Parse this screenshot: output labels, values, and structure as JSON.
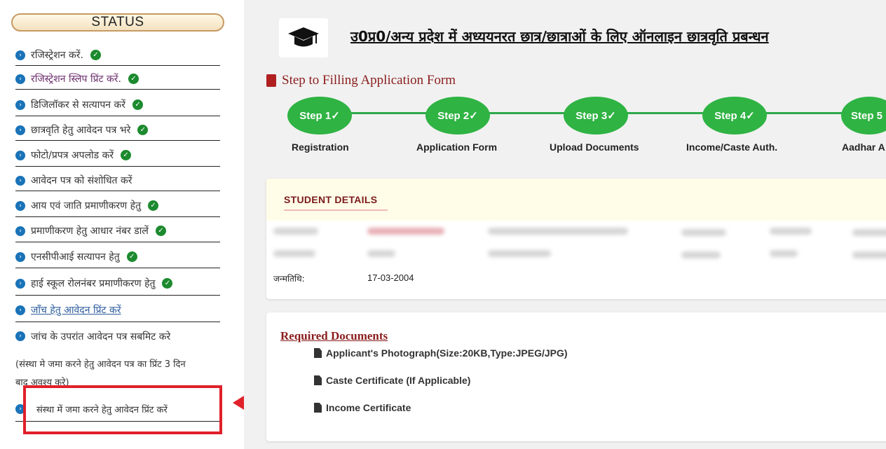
{
  "sidebar": {
    "status_title": "STATUS",
    "items": [
      {
        "label": "रजिस्ट्रेशन करें.",
        "done": true
      },
      {
        "label": "रजिस्ट्रेशन स्लिप प्रिंट करें.",
        "done": true
      },
      {
        "label": "डिजिलॉकर से सत्यापन करें",
        "done": true
      },
      {
        "label": "छात्रवृति हेतु आवेदन पत्र भरे",
        "done": true
      },
      {
        "label": "फोटो/प्रपत्र अपलोड करें",
        "done": true
      },
      {
        "label": "आवेदन पत्र को संशोधित करें",
        "done": false
      },
      {
        "label": "आय एवं जाति प्रमाणीकरण हेतु",
        "done": true
      },
      {
        "label": "प्रमाणीकरण हेतु आधार नंबर डालें",
        "done": true
      },
      {
        "label": "एनसीपीआई सत्यापन हेतु",
        "done": true
      },
      {
        "label": "हाई स्कूल रोलनंबर प्रमाणीकरण हेतु",
        "done": true
      },
      {
        "label": "जाँच हेतु आवेदन प्रिंट करें",
        "done": false
      },
      {
        "label": "जांच के उपरांत आवेदन पत्र सबमिट करे",
        "done": false
      }
    ],
    "note_line1": "(संस्था मे जमा करने हेतु आवेदन पत्र का प्रिंट 3 दिन",
    "note_line2": "बाद अवश्य करे)",
    "last_item": "संस्था में जमा करने हेतु आवेदन प्रिंट करें"
  },
  "header": {
    "title": "उ0प्र0/अन्य प्रदेश में अध्ययनरत छात्र/छात्राओं के लिए ऑनलाइन छात्रवृति प्रबन्धन"
  },
  "steps_label": "Step to Filling Application Form",
  "steps": [
    {
      "badge": "Step 1",
      "label": "Registration"
    },
    {
      "badge": "Step 2",
      "label": "Application Form"
    },
    {
      "badge": "Step 3",
      "label": "Upload Documents"
    },
    {
      "badge": "Step 4",
      "label": "Income/Caste Auth."
    },
    {
      "badge": "Step 5",
      "label": "Aadhar A"
    }
  ],
  "student_details": {
    "title": "STUDENT DETAILS",
    "dob_label": "जन्मतिथि:",
    "dob_value": "17-03-2004"
  },
  "required_documents": {
    "title": "Required Documents",
    "items": [
      "Applicant's Photograph(Size:20KB,Type:JPEG/JPG)",
      "Caste Certificate (If Applicable)",
      "Income Certificate"
    ]
  },
  "colors": {
    "step_green": "#2fb343",
    "highlight_red": "#e0202a",
    "maroon": "#8b1d1d"
  }
}
